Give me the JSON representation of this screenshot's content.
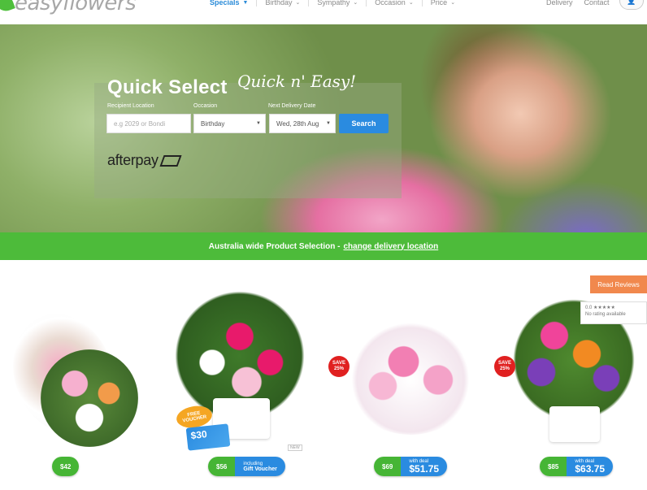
{
  "header": {
    "logo_text": "easyflowers",
    "nav": [
      {
        "label": "Specials"
      },
      {
        "label": "Birthday"
      },
      {
        "label": "Sympathy"
      },
      {
        "label": "Occasion"
      },
      {
        "label": "Price"
      }
    ],
    "links": [
      "Delivery",
      "Contact"
    ]
  },
  "hero": {
    "title": "Quick Select",
    "script": "Quick n' Easy!",
    "fields": {
      "location_label": "Recipient Location",
      "location_placeholder": "e.g 2029 or Bondi",
      "occasion_label": "Occasion",
      "occasion_value": "Birthday",
      "date_label": "Next Delivery Date",
      "date_value": "Wed, 28th Aug"
    },
    "search_label": "Search",
    "afterpay_text": "afterpay"
  },
  "banner": {
    "text": "Australia wide Product Selection -",
    "link": "change delivery location"
  },
  "products": [
    {
      "price": "$42",
      "type": "single"
    },
    {
      "price": "$56",
      "deal_line1": "including",
      "deal_line2": "Gift Voucher",
      "voucher_tag_1": "FREE",
      "voucher_tag_2": "VOUCHER",
      "voucher_amount": "$30",
      "new_label": "NEW"
    },
    {
      "price": "$69",
      "deal_line1": "with deal",
      "deal_price": "$51.75",
      "save_1": "SAVE",
      "save_2": "25%"
    },
    {
      "price": "$85",
      "deal_line1": "with deal",
      "deal_price": "$63.75",
      "save_1": "SAVE",
      "save_2": "25%"
    }
  ],
  "reviews": {
    "button": "Read Reviews",
    "rating": "0.0 ★★★★★",
    "no_rating": "No rating available"
  }
}
